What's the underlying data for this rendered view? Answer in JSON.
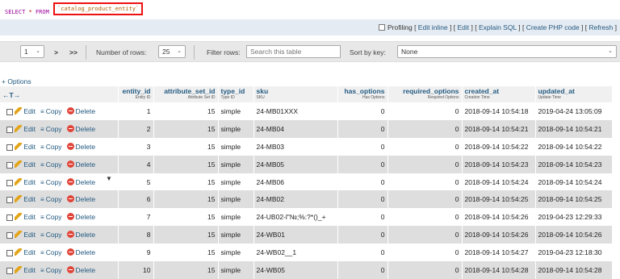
{
  "query": {
    "select_kw": "SELECT",
    "star": "*",
    "from_kw": "FROM",
    "table": "`catalog_product_entity`"
  },
  "links": {
    "profiling": "Profiling",
    "edit_inline": "Edit inline",
    "edit": "Edit",
    "explain_sql": "Explain SQL",
    "create_php_code": "Create PHP code",
    "refresh": "Refresh"
  },
  "nav": {
    "page_value": "1",
    "next": ">",
    "last": ">>",
    "rows_label": "Number of rows:",
    "rows_value": "25",
    "filter_label": "Filter rows:",
    "filter_placeholder": "Search this table",
    "sort_label": "Sort by key:",
    "sort_value": "None"
  },
  "options_label": "+ Options",
  "columns": [
    {
      "name": "entity_id",
      "sub": "Entity ID"
    },
    {
      "name": "attribute_set_id",
      "sub": "Attribute Set ID"
    },
    {
      "name": "type_id",
      "sub": "Type ID"
    },
    {
      "name": "sku",
      "sub": "SKU"
    },
    {
      "name": "has_options",
      "sub": "Has Options"
    },
    {
      "name": "required_options",
      "sub": "Required Options"
    },
    {
      "name": "created_at",
      "sub": "Creation Time"
    },
    {
      "name": "updated_at",
      "sub": "Update Time"
    }
  ],
  "row_actions": {
    "edit": "Edit",
    "copy": "Copy",
    "delete": "Delete"
  },
  "rows": [
    {
      "entity_id": "1",
      "attribute_set_id": "15",
      "type_id": "simple",
      "sku": "24-MB01XXX",
      "has_options": "0",
      "required_options": "0",
      "created_at": "2018-09-14 10:54:18",
      "updated_at": "2019-04-24 13:05:09"
    },
    {
      "entity_id": "2",
      "attribute_set_id": "15",
      "type_id": "simple",
      "sku": "24-MB04",
      "has_options": "0",
      "required_options": "0",
      "created_at": "2018-09-14 10:54:21",
      "updated_at": "2018-09-14 10:54:21"
    },
    {
      "entity_id": "3",
      "attribute_set_id": "15",
      "type_id": "simple",
      "sku": "24-MB03",
      "has_options": "0",
      "required_options": "0",
      "created_at": "2018-09-14 10:54:22",
      "updated_at": "2018-09-14 10:54:22"
    },
    {
      "entity_id": "4",
      "attribute_set_id": "15",
      "type_id": "simple",
      "sku": "24-MB05",
      "has_options": "0",
      "required_options": "0",
      "created_at": "2018-09-14 10:54:23",
      "updated_at": "2018-09-14 10:54:23"
    },
    {
      "entity_id": "5",
      "attribute_set_id": "15",
      "type_id": "simple",
      "sku": "24-MB06",
      "has_options": "0",
      "required_options": "0",
      "created_at": "2018-09-14 10:54:24",
      "updated_at": "2018-09-14 10:54:24"
    },
    {
      "entity_id": "6",
      "attribute_set_id": "15",
      "type_id": "simple",
      "sku": "24-MB02",
      "has_options": "0",
      "required_options": "0",
      "created_at": "2018-09-14 10:54:25",
      "updated_at": "2018-09-14 10:54:25"
    },
    {
      "entity_id": "7",
      "attribute_set_id": "15",
      "type_id": "simple",
      "sku": "24-UB02-l\"№;%:?*()_+",
      "has_options": "0",
      "required_options": "0",
      "created_at": "2018-09-14 10:54:26",
      "updated_at": "2019-04-23 12:29:33"
    },
    {
      "entity_id": "8",
      "attribute_set_id": "15",
      "type_id": "simple",
      "sku": "24-WB01",
      "has_options": "0",
      "required_options": "0",
      "created_at": "2018-09-14 10:54:26",
      "updated_at": "2018-09-14 10:54:26"
    },
    {
      "entity_id": "9",
      "attribute_set_id": "15",
      "type_id": "simple",
      "sku": "24-WB02__1",
      "has_options": "0",
      "required_options": "0",
      "created_at": "2018-09-14 10:54:27",
      "updated_at": "2019-04-23 12:18:30"
    },
    {
      "entity_id": "10",
      "attribute_set_id": "15",
      "type_id": "simple",
      "sku": "24-WB05",
      "has_options": "0",
      "required_options": "0",
      "created_at": "2018-09-14 10:54:28",
      "updated_at": "2018-09-14 10:54:28"
    }
  ]
}
